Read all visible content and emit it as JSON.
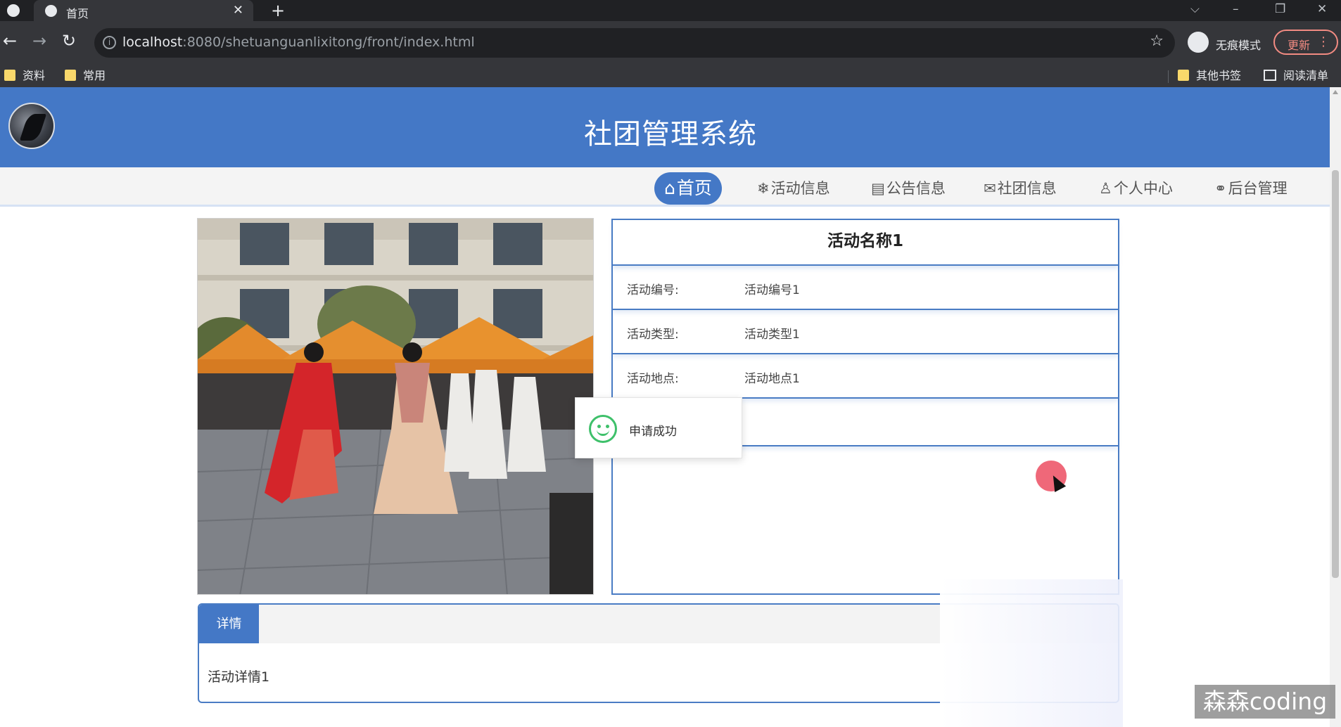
{
  "browser": {
    "tab_title": "首页",
    "tab_close": "✕",
    "new_tab": "+",
    "window_controls": {
      "tab_search": "⌵",
      "minimize": "–",
      "restore": "❐",
      "close": "✕"
    },
    "nav": {
      "back": "←",
      "forward": "→",
      "reload": "↻"
    },
    "url_host": "localhost",
    "url_path": ":8080/shetuanguanlixitong/front/index.html",
    "star": "☆",
    "profile_label": "无痕模式",
    "update_label": "更新",
    "menu": "⋮",
    "bookmarks": {
      "left": [
        "资料",
        "常用"
      ],
      "other": "其他书签",
      "reading_list": "阅读清单"
    }
  },
  "site": {
    "title": "社团管理系统",
    "nav": [
      {
        "glyph": "⌂",
        "label": "首页",
        "active": true
      },
      {
        "glyph": "❄",
        "label": "活动信息"
      },
      {
        "glyph": "▤",
        "label": "公告信息"
      },
      {
        "glyph": "✉",
        "label": "社团信息"
      },
      {
        "glyph": "♙",
        "label": "个人中心"
      },
      {
        "glyph": "⚭",
        "label": "后台管理"
      }
    ]
  },
  "activity": {
    "name": "活动名称1",
    "fields": [
      {
        "label": "活动编号:",
        "value": "活动编号1"
      },
      {
        "label": "活动类型:",
        "value": "活动类型1"
      },
      {
        "label": "活动地点:",
        "value": "活动地点1"
      }
    ]
  },
  "toast": {
    "message": "申请成功"
  },
  "detail": {
    "tab_label": "详情",
    "content": "活动详情1"
  },
  "watermark": "森森coding",
  "colors": {
    "header_blue": "#4478c6",
    "panel_border": "#4a7cc4",
    "success_green": "#3ec06a",
    "cursor_highlight": "#ec4e62"
  }
}
